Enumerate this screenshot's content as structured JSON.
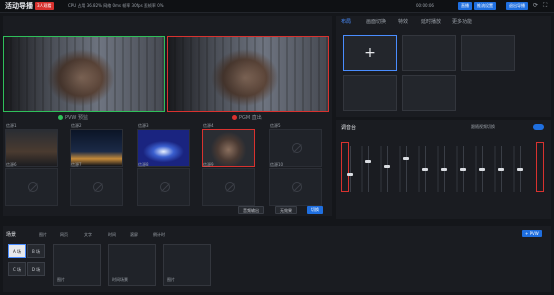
{
  "app": {
    "title": "活动导播",
    "badge": "3人观看",
    "stats": "CPU 占用 36.82% 网络 0ms 帧率 30fps 丢帧率 0%",
    "live_time": "00:00:06",
    "buttons": [
      "直播",
      "推流设置",
      "退出导播"
    ]
  },
  "stage": {
    "preview_label": "PVW 预监",
    "program_label": "PGM 直出",
    "cam_labels": [
      "信源1",
      "信源2",
      "信源3",
      "信源4",
      "信源5"
    ],
    "cam_labels_row2": [
      "信源6",
      "信源7",
      "信源8",
      "信源9",
      "信源10"
    ],
    "controls": {
      "audio": "音频输出",
      "transition": "无效果",
      "cut": "切换"
    }
  },
  "right": {
    "tabs": [
      "布局",
      "画面切换",
      "特效",
      "延时播放",
      "更多功能"
    ],
    "add_label": "+"
  },
  "mixer": {
    "title": "调音台",
    "follow_label": "跟随视频切换"
  },
  "scene": {
    "title": "场景",
    "scene_buttons": [
      "A 场",
      "B 场",
      "C 场",
      "D 场"
    ],
    "tools": [
      "图片",
      "网页",
      "文字",
      "时间",
      "滚屏",
      "倒计时"
    ],
    "cards": [
      "图片",
      "时间场景",
      "图片"
    ],
    "add_btn": "+ PVW"
  },
  "colors": {
    "accent": "#1f6fe0",
    "pgm": "#d8322f",
    "pvw": "#2fbf5a"
  }
}
